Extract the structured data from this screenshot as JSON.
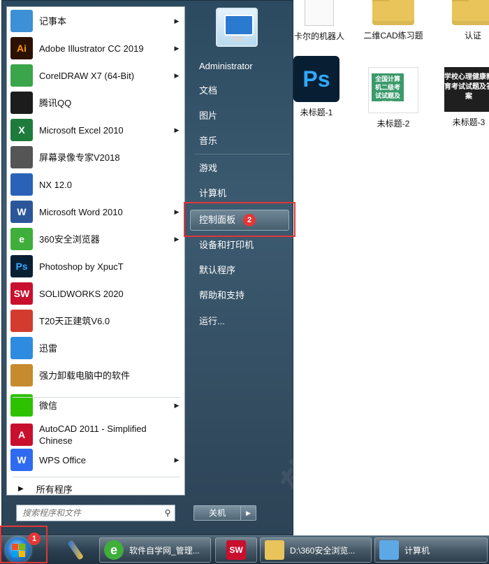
{
  "desktop": {
    "icons": [
      {
        "label": "卡尔的机器人",
        "kind": "pages"
      },
      {
        "label": "二维CAD练习题",
        "kind": "folder"
      },
      {
        "label": "认证",
        "kind": "folder"
      },
      {
        "label": "未标题-1",
        "kind": "ps",
        "badge_text": "Ps"
      },
      {
        "label": "未标题-2",
        "kind": "cover",
        "cover_text": "全国计算机二级考试试题及答案"
      },
      {
        "label": "未标题-3",
        "kind": "cover2",
        "cover_text": "学校心理健康教育考试试题及答案"
      }
    ]
  },
  "start_menu": {
    "programs": [
      {
        "label": "记事本",
        "icon": "notepad-icon",
        "icon_text": "",
        "color": "#3d8fd6",
        "arrow": true
      },
      {
        "label": "Adobe Illustrator CC 2019",
        "icon": "illustrator-icon",
        "icon_text": "Ai",
        "color": "#2b1100",
        "text_color": "#ff9a00",
        "arrow": true
      },
      {
        "label": "CorelDRAW X7 (64-Bit)",
        "icon": "coreldraw-icon",
        "icon_text": "",
        "color": "#3aa54a",
        "arrow": true
      },
      {
        "label": "腾讯QQ",
        "icon": "qq-penguin-icon",
        "icon_text": "",
        "color": "#1c1c1c",
        "arrow": false
      },
      {
        "label": "Microsoft Excel 2010",
        "icon": "excel-icon",
        "icon_text": "X",
        "color": "#1e7b3c",
        "arrow": true
      },
      {
        "label": "屏幕录像专家V2018",
        "icon": "film-reel-icon",
        "icon_text": "",
        "color": "#555555",
        "arrow": false
      },
      {
        "label": "NX 12.0",
        "icon": "nx-icon",
        "icon_text": "",
        "color": "#2a62b8",
        "arrow": false
      },
      {
        "label": "Microsoft Word 2010",
        "icon": "word-icon",
        "icon_text": "W",
        "color": "#2b579a",
        "arrow": true
      },
      {
        "label": "360安全浏览器",
        "icon": "browser-360-icon",
        "icon_text": "e",
        "color": "#3fae3a",
        "arrow": true
      },
      {
        "label": "Photoshop by XpucT",
        "icon": "photoshop-icon",
        "icon_text": "Ps",
        "color": "#081f33",
        "text_color": "#31a8ff",
        "arrow": false
      },
      {
        "label": "SOLIDWORKS 2020",
        "icon": "solidworks-icon",
        "icon_text": "SW",
        "color": "#c8102e",
        "arrow": false
      },
      {
        "label": "T20天正建筑V6.0",
        "icon": "tangent-icon",
        "icon_text": "",
        "color": "#d43b2f",
        "arrow": false
      },
      {
        "label": "迅雷",
        "icon": "thunder-bird-icon",
        "icon_text": "",
        "color": "#2f8be0",
        "arrow": false
      },
      {
        "label": "强力卸载电脑中的软件",
        "icon": "uninstall-box-icon",
        "icon_text": "",
        "color": "#c58b2e",
        "arrow": false
      },
      {
        "label": "微信",
        "icon": "wechat-icon",
        "icon_text": "",
        "color": "#2dc100",
        "arrow": true
      },
      {
        "label": "AutoCAD 2011 - Simplified Chinese",
        "icon": "autocad-icon",
        "icon_text": "A",
        "color": "#c8102e",
        "arrow": false
      },
      {
        "label": "WPS Office",
        "icon": "wps-icon",
        "icon_text": "W",
        "color": "#2f6bf0",
        "arrow": true
      }
    ],
    "all_programs": "所有程序",
    "search_placeholder": "搜索程序和文件",
    "right_items": [
      "Administrator",
      "文档",
      "图片",
      "音乐",
      "游戏",
      "计算机",
      "控制面板",
      "设备和打印机",
      "默认程序",
      "帮助和支持",
      "运行..."
    ],
    "shutdown_label": "关机",
    "watermark": "软件自学网 WWW.RJZXW.COM"
  },
  "annotations": {
    "step1": "1",
    "step2": "2"
  },
  "taskbar": {
    "items": [
      {
        "label": "",
        "icon": "paint-brush-icon"
      },
      {
        "label": "软件自学网_管理...",
        "icon": "browser-360-icon"
      },
      {
        "label": "",
        "icon": "solidworks-icon",
        "icon_text": "SW"
      },
      {
        "label": "D:\\360安全浏览...",
        "icon": "folder-icon"
      },
      {
        "label": "计算机",
        "icon": "computer-icon"
      }
    ]
  }
}
